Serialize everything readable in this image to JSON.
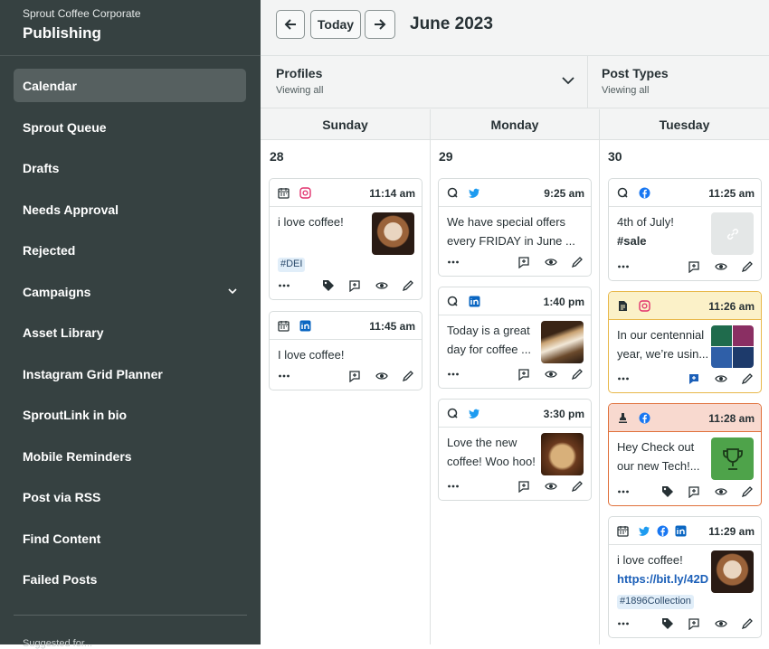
{
  "sidebar": {
    "org": "Sprout Coffee Corporate",
    "app_title": "Publishing",
    "items": [
      {
        "label": "Calendar"
      },
      {
        "label": "Sprout Queue"
      },
      {
        "label": "Drafts"
      },
      {
        "label": "Needs Approval"
      },
      {
        "label": "Rejected"
      },
      {
        "label": "Campaigns"
      },
      {
        "label": "Asset Library"
      },
      {
        "label": "Instagram Grid Planner"
      },
      {
        "label": "SproutLink in bio"
      },
      {
        "label": "Mobile Reminders"
      },
      {
        "label": "Post via RSS"
      },
      {
        "label": "Find Content"
      },
      {
        "label": "Failed Posts"
      }
    ],
    "footer_partial": "Suggested for..."
  },
  "header": {
    "today_label": "Today",
    "month": "June 2023"
  },
  "filters": {
    "profiles_title": "Profiles",
    "profiles_sub": "Viewing all",
    "types_title": "Post Types",
    "types_sub": "Viewing all"
  },
  "columns": [
    {
      "day": "Sunday",
      "date": "28"
    },
    {
      "day": "Monday",
      "date": "29"
    },
    {
      "day": "Tuesday",
      "date": "30"
    }
  ],
  "posts": {
    "sun1": {
      "time": "11:14 am",
      "text": "i love coffee!",
      "tag": "#DEI"
    },
    "sun2": {
      "time": "11:45 am",
      "text": "I love coffee!"
    },
    "mon1": {
      "time": "9:25 am",
      "text1": "We have special offers",
      "text2": "every FRIDAY in June ..."
    },
    "mon2": {
      "time": "1:40 pm",
      "text1": "Today is a great",
      "text2": "day for coffee ..."
    },
    "mon3": {
      "time": "3:30 pm",
      "text1": "Love the new",
      "text2": "coffee! Woo hoo!"
    },
    "tue1": {
      "time": "11:25 am",
      "text1": "4th of July!",
      "text2": "#sale"
    },
    "tue2": {
      "time": "11:26 am",
      "text1": "In our centennial",
      "text2": "year, we’re usin..."
    },
    "tue3": {
      "time": "11:28 am",
      "text1": "Hey Check out",
      "text2": "our new Tech!..."
    },
    "tue4": {
      "time": "11:29 am",
      "text1": "i love coffee!",
      "text2": "https://bit.ly/42D",
      "tag": "#1896Collection"
    }
  },
  "colors": {
    "sidebar": "#364141",
    "twitter": "#1d9bf0",
    "facebook": "#1877f2",
    "linkedin": "#0a66c2",
    "instagram": "#e1306c",
    "draft_bg": "#fbf1c8",
    "draft_border": "#e8b84a",
    "approval_bg": "#f8d9cf",
    "approval_border": "#e0703a"
  }
}
